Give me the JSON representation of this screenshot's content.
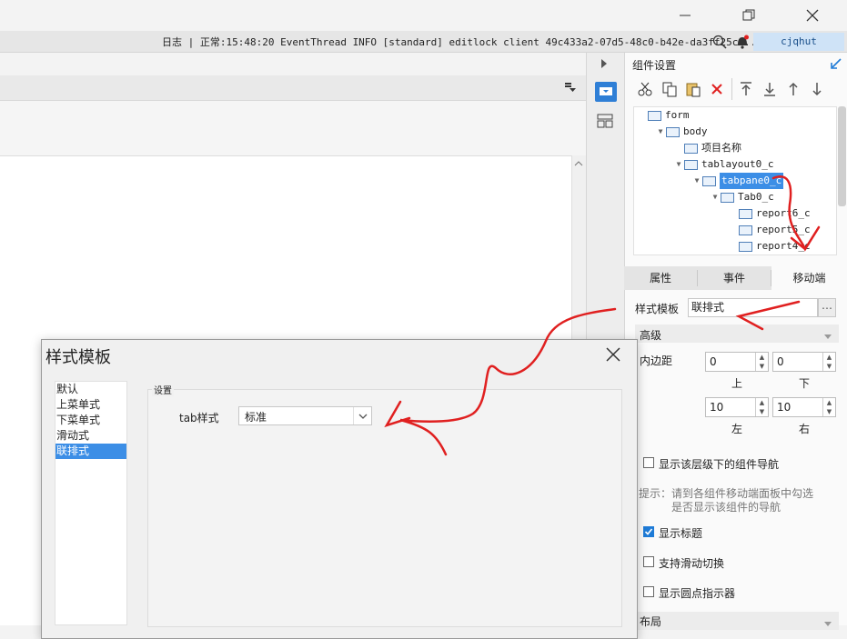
{
  "window": {
    "min_icon": "minimize-icon",
    "max_icon": "restore-icon",
    "close_icon": "close-icon"
  },
  "logbar": {
    "text": "日志 | 正常:15:48:20 EventThread INFO [standard] editlock client 49c433a2-07d5-48c0-b42e-da3ff25c...",
    "user": "cjqhut"
  },
  "right_panel": {
    "title": "组件设置",
    "tree": [
      {
        "label": "form",
        "indent": 0,
        "arrow": ""
      },
      {
        "label": "body",
        "indent": 1,
        "arrow": "▼"
      },
      {
        "label": "项目名称",
        "indent": 2,
        "arrow": ""
      },
      {
        "label": "tablayout0_c",
        "indent": 2,
        "arrow": "▼"
      },
      {
        "label": "tabpane0_c",
        "indent": 3,
        "arrow": "▼",
        "selected": true
      },
      {
        "label": "Tab0_c",
        "indent": 4,
        "arrow": "▼"
      },
      {
        "label": "report6_c",
        "indent": 5,
        "arrow": ""
      },
      {
        "label": "report5_c",
        "indent": 5,
        "arrow": ""
      },
      {
        "label": "report4_c",
        "indent": 5,
        "arrow": ""
      }
    ],
    "tabs": [
      "属性",
      "事件",
      "移动端"
    ],
    "active_tab": "移动端",
    "style_template_label": "样式模板",
    "style_template_value": "联排式",
    "advanced_label": "高级",
    "padding_label": "内边距",
    "padding": {
      "top": "0",
      "bottom": "0",
      "left": "10",
      "right": "10"
    },
    "padding_captions": {
      "top": "上",
      "bottom": "下",
      "left": "左",
      "right": "右"
    },
    "show_nav_label": "显示该层级下的组件导航",
    "hint": "提示：请到各组件移动端面板中勾选\n是否显示该组件的导航",
    "hint_prefix": "提示：",
    "hint_line1": "请到各组件移动端面板中勾选",
    "hint_line2": "是否显示该组件的导航",
    "show_title_label": "显示标题",
    "swipe_label": "支持滑动切换",
    "dots_label": "显示圆点指示器",
    "layout_label": "布局",
    "show_nav_checked": false,
    "show_title_checked": true,
    "swipe_checked": false,
    "dots_checked": false
  },
  "dialog": {
    "title": "样式模板",
    "items": [
      "默认",
      "上菜单式",
      "下菜单式",
      "滑动式",
      "联排式"
    ],
    "selected_item": "联排式",
    "group_label": "设置",
    "tab_style_label": "tab样式",
    "tab_style_value": "标准"
  },
  "colors": {
    "accent": "#1e7bd7",
    "selection": "#3c8ee6",
    "annotation": "#e02020"
  }
}
